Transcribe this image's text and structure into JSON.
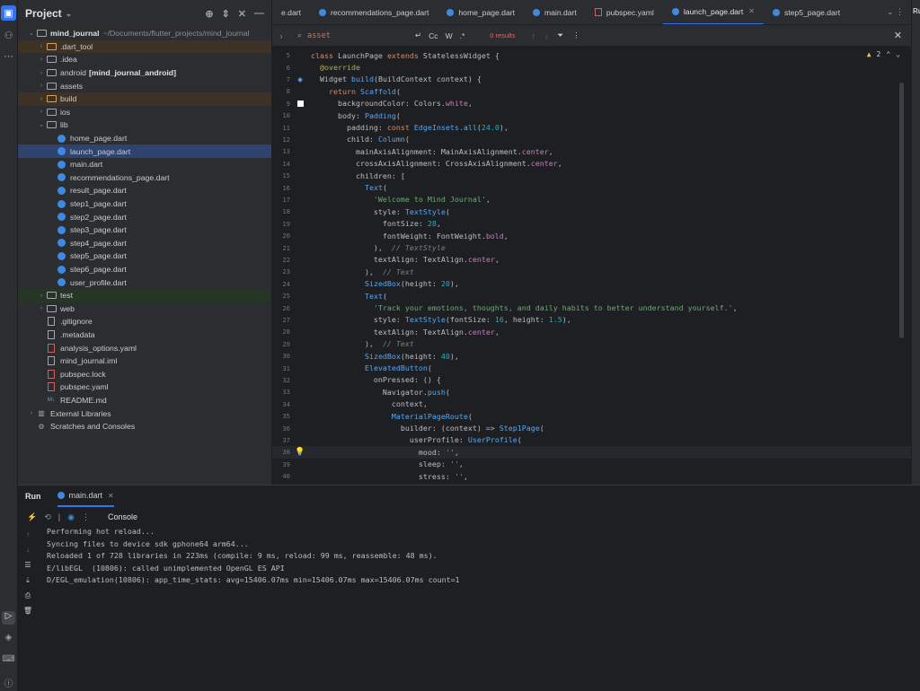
{
  "project_panel": {
    "title": "Project",
    "tree": [
      {
        "label": "mind_journal",
        "extra": "~/Documents/flutter_projects/mind_journal",
        "depth": 0,
        "kind": "root",
        "arrow": "open"
      },
      {
        "label": ".dart_tool",
        "depth": 1,
        "kind": "folder-orange",
        "arrow": "closed",
        "style": "excl"
      },
      {
        "label": ".idea",
        "depth": 1,
        "kind": "folder",
        "arrow": "closed"
      },
      {
        "label": "android",
        "extra_bold": "[mind_journal_android]",
        "depth": 1,
        "kind": "folder",
        "arrow": "closed"
      },
      {
        "label": "assets",
        "depth": 1,
        "kind": "folder",
        "arrow": "closed"
      },
      {
        "label": "build",
        "depth": 1,
        "kind": "folder-orange",
        "arrow": "closed",
        "style": "excl"
      },
      {
        "label": "ios",
        "depth": 1,
        "kind": "folder",
        "arrow": "closed"
      },
      {
        "label": "lib",
        "depth": 1,
        "kind": "folder",
        "arrow": "open"
      },
      {
        "label": "home_page.dart",
        "depth": 2,
        "kind": "dart"
      },
      {
        "label": "launch_page.dart",
        "depth": 2,
        "kind": "dart",
        "style": "sel"
      },
      {
        "label": "main.dart",
        "depth": 2,
        "kind": "dart"
      },
      {
        "label": "recommendations_page.dart",
        "depth": 2,
        "kind": "dart"
      },
      {
        "label": "result_page.dart",
        "depth": 2,
        "kind": "dart"
      },
      {
        "label": "step1_page.dart",
        "depth": 2,
        "kind": "dart"
      },
      {
        "label": "step2_page.dart",
        "depth": 2,
        "kind": "dart"
      },
      {
        "label": "step3_page.dart",
        "depth": 2,
        "kind": "dart"
      },
      {
        "label": "step4_page.dart",
        "depth": 2,
        "kind": "dart"
      },
      {
        "label": "step5_page.dart",
        "depth": 2,
        "kind": "dart"
      },
      {
        "label": "step6_page.dart",
        "depth": 2,
        "kind": "dart"
      },
      {
        "label": "user_profile.dart",
        "depth": 2,
        "kind": "dart"
      },
      {
        "label": "test",
        "depth": 1,
        "kind": "folder",
        "arrow": "closed",
        "style": "testrow"
      },
      {
        "label": "web",
        "depth": 1,
        "kind": "folder",
        "arrow": "closed"
      },
      {
        "label": ".gitignore",
        "depth": 1,
        "kind": "file"
      },
      {
        "label": ".metadata",
        "depth": 1,
        "kind": "file"
      },
      {
        "label": "analysis_options.yaml",
        "depth": 1,
        "kind": "file-red"
      },
      {
        "label": "mind_journal.iml",
        "depth": 1,
        "kind": "file"
      },
      {
        "label": "pubspec.lock",
        "depth": 1,
        "kind": "file-red"
      },
      {
        "label": "pubspec.yaml",
        "depth": 1,
        "kind": "file-red"
      },
      {
        "label": "README.md",
        "depth": 1,
        "kind": "md"
      },
      {
        "label": "External Libraries",
        "depth": 0,
        "kind": "lib",
        "arrow": "closed"
      },
      {
        "label": "Scratches and Consoles",
        "depth": 0,
        "kind": "scratch"
      }
    ]
  },
  "tabs": [
    {
      "label": "e.dart",
      "icon": "none"
    },
    {
      "label": "recommendations_page.dart",
      "icon": "dart"
    },
    {
      "label": "home_page.dart",
      "icon": "dart"
    },
    {
      "label": "main.dart",
      "icon": "dart"
    },
    {
      "label": "pubspec.yaml",
      "icon": "yaml"
    },
    {
      "label": "launch_page.dart",
      "icon": "dart",
      "active": true
    },
    {
      "label": "step5_page.dart",
      "icon": "dart"
    }
  ],
  "right_strip_label": "Ru",
  "find_bar": {
    "query": "asset",
    "case_label": "Cc",
    "word_label": "W",
    "regex_label": ".*",
    "results": "0 results"
  },
  "editor": {
    "warnings": "2",
    "lines": [
      {
        "n": "5",
        "html": "<span class='kw'>class</span> LaunchPage <span class='kw'>extends</span> StatelessWidget {"
      },
      {
        "n": "6",
        "html": "  <span class='ann'>@override</span>"
      },
      {
        "n": "7",
        "html": "  Widget <span class='cls'>build</span>(BuildContext context) {",
        "gutter": "run"
      },
      {
        "n": "8",
        "html": "    <span class='kw'>return</span> <span class='cls'>Scaffold</span>("
      },
      {
        "n": "9",
        "html": "      backgroundColor: Colors.<span class='fld'>white</span>,",
        "gutter": "swatch"
      },
      {
        "n": "10",
        "html": "      body: <span class='cls'>Padding</span>("
      },
      {
        "n": "11",
        "html": "        padding: <span class='kw'>const</span> <span class='cls'>EdgeInsets.all</span>(<span class='num2'>24.0</span>),"
      },
      {
        "n": "12",
        "html": "        child: <span class='cls'>Column</span>("
      },
      {
        "n": "13",
        "html": "          mainAxisAlignment: MainAxisAlignment.<span class='fld'>center</span>,"
      },
      {
        "n": "14",
        "html": "          crossAxisAlignment: CrossAxisAlignment.<span class='fld'>center</span>,"
      },
      {
        "n": "15",
        "html": "          children: ["
      },
      {
        "n": "16",
        "html": "            <span class='cls'>Text</span>("
      },
      {
        "n": "17",
        "html": "              <span class='str'>'Welcome to Mind Journal'</span>,"
      },
      {
        "n": "18",
        "html": "              style: <span class='cls'>TextStyle</span>("
      },
      {
        "n": "19",
        "html": "                fontSize: <span class='num2'>28</span>,"
      },
      {
        "n": "20",
        "html": "                fontWeight: FontWeight.<span class='fld'>bold</span>,"
      },
      {
        "n": "21",
        "html": "              ),  <span class='cm'>// TextStyle</span>"
      },
      {
        "n": "22",
        "html": "              textAlign: TextAlign.<span class='fld'>center</span>,"
      },
      {
        "n": "23",
        "html": "            ),  <span class='cm'>// Text</span>"
      },
      {
        "n": "24",
        "html": "            <span class='cls'>SizedBox</span>(height: <span class='num2'>20</span>),"
      },
      {
        "n": "25",
        "html": "            <span class='cls'>Text</span>("
      },
      {
        "n": "26",
        "html": "              <span class='str'>'Track your emotions, thoughts, and daily habits to better understand yourself.'</span>,"
      },
      {
        "n": "27",
        "html": "              style: <span class='cls'>TextStyle</span>(fontSize: <span class='num2'>16</span>, height: <span class='num2'>1.5</span>),"
      },
      {
        "n": "28",
        "html": "              textAlign: TextAlign.<span class='fld'>center</span>,"
      },
      {
        "n": "29",
        "html": "            ),  <span class='cm'>// Text</span>"
      },
      {
        "n": "30",
        "html": "            <span class='cls'>SizedBox</span>(height: <span class='num2'>40</span>),"
      },
      {
        "n": "31",
        "html": "            <span class='cls'>ElevatedButton</span>("
      },
      {
        "n": "32",
        "html": "              onPressed: () {"
      },
      {
        "n": "33",
        "html": "                Navigator.<span class='cls'>push</span>("
      },
      {
        "n": "34",
        "html": "                  context,"
      },
      {
        "n": "35",
        "html": "                  <span class='cls'>MaterialPageRoute</span>("
      },
      {
        "n": "36",
        "html": "                    builder: (context) =&gt; <span class='cls'>Step1Page</span>("
      },
      {
        "n": "37",
        "html": "                      userProfile: <span class='cls'>UserProfile</span>("
      },
      {
        "n": "38",
        "html": "                        mood: <span class='str'>''</span>,",
        "gutter": "bulb",
        "current": true
      },
      {
        "n": "39",
        "html": "                        sleep: <span class='str'>''</span>,"
      },
      {
        "n": "40",
        "html": "                        stress: <span class='str'>''</span>,"
      }
    ]
  },
  "run_panel": {
    "title": "Run",
    "tab_label": "main.dart",
    "console_label": "Console",
    "lines": [
      "Performing hot reload...",
      "Syncing files to device sdk gphone64 arm64...",
      "Reloaded 1 of 728 libraries in 223ms (compile: 9 ms, reload: 99 ms, reassemble: 48 ms).",
      "E/libEGL  (10806): called unimplemented OpenGL ES API",
      "D/EGL_emulation(10806): app_time_stats: avg=15406.07ms min=15406.07ms max=15406.07ms count=1"
    ]
  }
}
